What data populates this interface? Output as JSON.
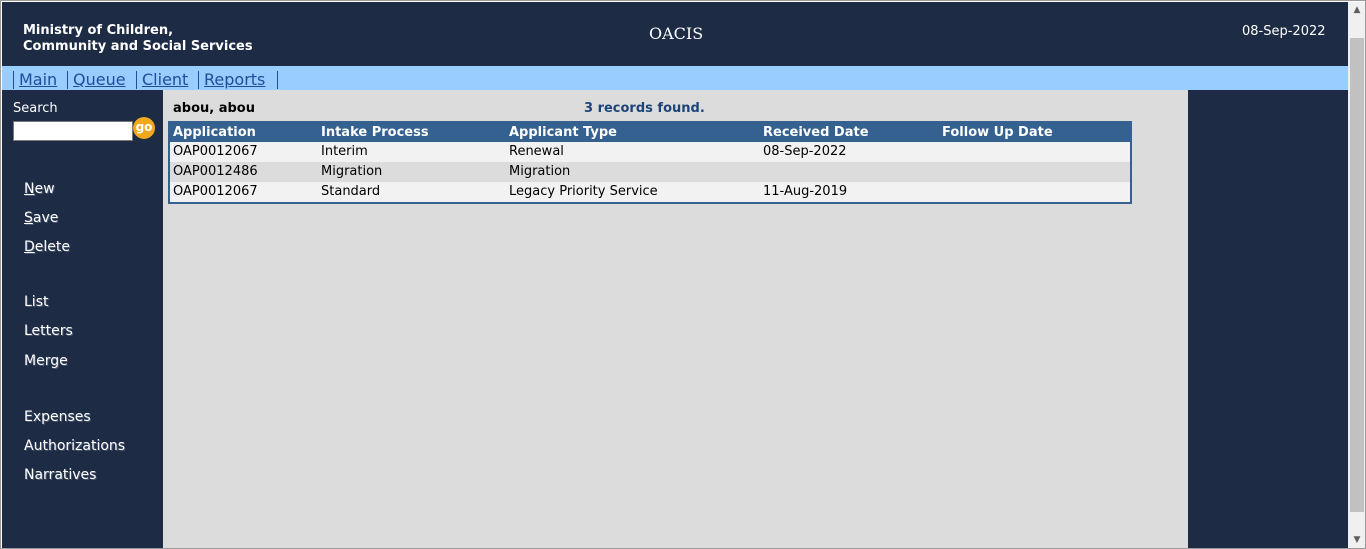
{
  "header": {
    "org_line1": "Ministry of Children,",
    "org_line2": "Community and Social Services",
    "app_title": "OACIS",
    "date": "08-Sep-2022"
  },
  "nav": {
    "items": [
      {
        "label": "Main"
      },
      {
        "label": "Queue"
      },
      {
        "label": "Client"
      },
      {
        "label": "Reports"
      }
    ]
  },
  "sidebar": {
    "search_label": "Search",
    "search_value": "",
    "go_label": "go",
    "actions": [
      {
        "label": "New",
        "mnemonic": "N",
        "rest": "ew"
      },
      {
        "label": "Save",
        "mnemonic": "S",
        "rest": "ave"
      },
      {
        "label": "Delete",
        "mnemonic": "D",
        "rest": "elete"
      }
    ],
    "links": [
      {
        "label": "List"
      },
      {
        "label": "Letters"
      },
      {
        "label": "Merge"
      },
      {
        "label": "Expenses"
      },
      {
        "label": "Authorizations"
      },
      {
        "label": "Narratives"
      }
    ]
  },
  "main": {
    "client_name": "abou, abou",
    "records_found": "3 records found.",
    "table": {
      "columns": [
        "Application",
        "Intake Process",
        "Applicant Type",
        "Received Date",
        "Follow Up Date"
      ],
      "rows": [
        [
          "OAP0012067",
          "Interim",
          "Renewal",
          "08-Sep-2022",
          ""
        ],
        [
          "OAP0012486",
          "Migration",
          "Migration",
          "",
          ""
        ],
        [
          "OAP0012067",
          "Standard",
          "Legacy Priority Service",
          "11-Aug-2019",
          ""
        ]
      ]
    }
  },
  "scrollbar": {
    "up_icon": "triangle-up-icon",
    "down_icon": "triangle-down-icon"
  },
  "colors": {
    "header_bg": "#1d2b45",
    "nav_bg": "#99ccff",
    "grid_header_bg": "#34618f",
    "go_button": "#f2a81d",
    "main_bg": "#dcdcdc"
  }
}
